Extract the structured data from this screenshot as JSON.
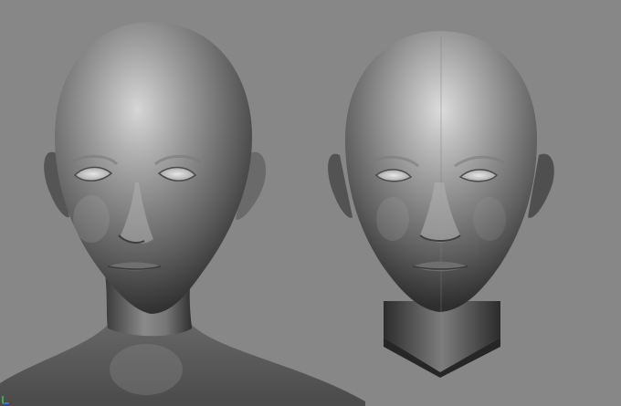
{
  "scene": {
    "background": "#878787",
    "models": [
      {
        "id": "bust-with-shoulders",
        "shade": "#5f5f5f"
      },
      {
        "id": "head-with-neck-cut",
        "shade": "#5f5f5f"
      }
    ],
    "axis_indicator_colors": [
      "#35d14a",
      "#3b7cff"
    ]
  }
}
